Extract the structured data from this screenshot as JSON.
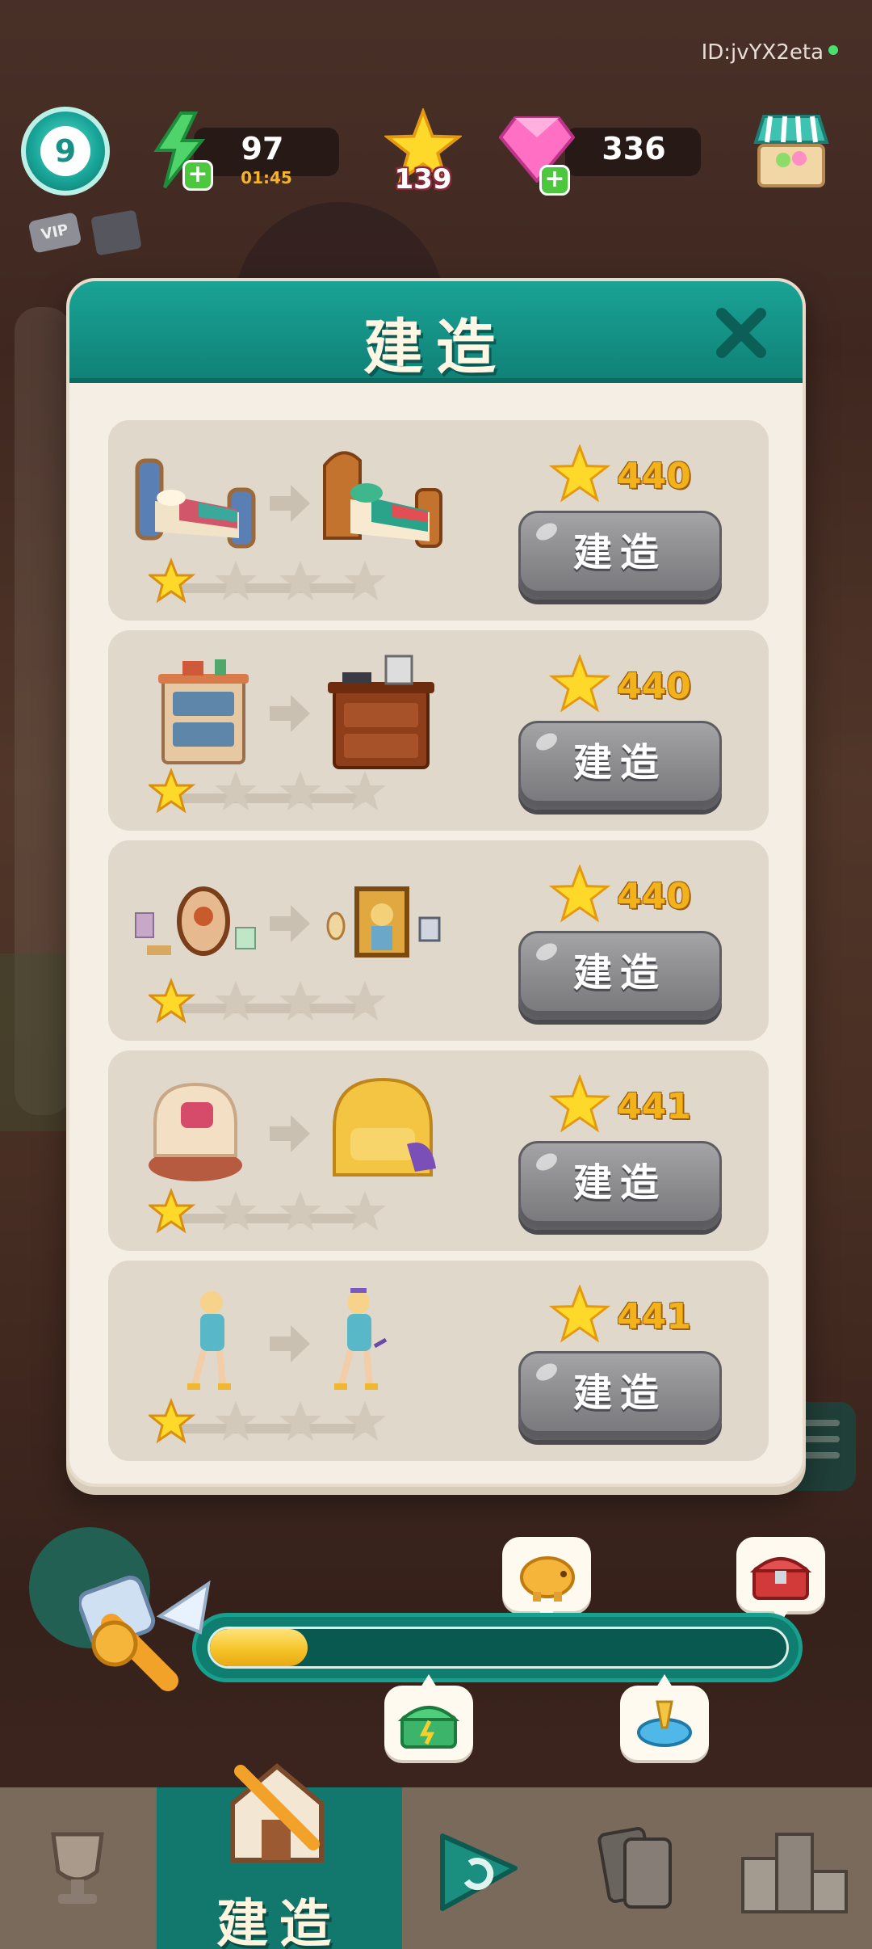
{
  "header": {
    "user_id": "ID:jvYX2eta",
    "level": "9",
    "energy": {
      "value": "97",
      "timer": "01:45"
    },
    "stars": "139",
    "gems": "336",
    "vip_label": "VIP"
  },
  "dialog": {
    "title": "建造",
    "items": [
      {
        "name": "bed",
        "cost": "440",
        "button": "建造",
        "stars_filled": 1,
        "stars_total": 4
      },
      {
        "name": "nightstand",
        "cost": "440",
        "button": "建造",
        "stars_filled": 1,
        "stars_total": 4
      },
      {
        "name": "wall-decor",
        "cost": "440",
        "button": "建造",
        "stars_filled": 1,
        "stars_total": 4
      },
      {
        "name": "armchair",
        "cost": "441",
        "button": "建造",
        "stars_filled": 1,
        "stars_total": 4
      },
      {
        "name": "character",
        "cost": "441",
        "button": "建造",
        "stars_filled": 1,
        "stars_total": 4
      }
    ]
  },
  "progress": {
    "fill_percent": 17
  },
  "bottom_nav": {
    "active_label": "建造"
  },
  "colors": {
    "teal": "#12776c",
    "gold": "#f2b21c",
    "cream": "#f4eee4",
    "button_gray": "#8a8a8d"
  }
}
